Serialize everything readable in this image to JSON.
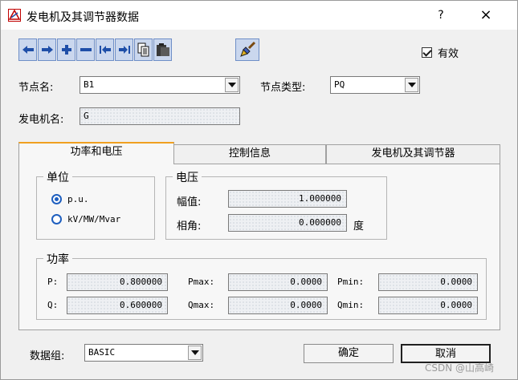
{
  "window": {
    "title": "发电机及其调节器数据",
    "help_label": "?",
    "close_label": "×"
  },
  "toolbar": {
    "buttons": [
      "arrow-left-icon",
      "arrow-right-icon",
      "plus-icon",
      "minus-icon",
      "first-record-icon",
      "last-record-icon",
      "copy-icon",
      "paste-icon"
    ],
    "brush": "brush-icon"
  },
  "valid_checkbox": {
    "label": "有效",
    "checked": true
  },
  "node": {
    "name_label": "节点名:",
    "name_value": "B1",
    "type_label": "节点类型:",
    "type_value": "PQ"
  },
  "generator": {
    "name_label": "发电机名:",
    "name_value": "G"
  },
  "tabs": [
    {
      "label": "功率和电压",
      "active": true
    },
    {
      "label": "控制信息",
      "active": false
    },
    {
      "label": "发电机及其调节器",
      "active": false
    }
  ],
  "unit_group": {
    "title": "单位",
    "options": [
      {
        "label": "p.u.",
        "selected": true
      },
      {
        "label": "kV/MW/Mvar",
        "selected": false
      }
    ]
  },
  "voltage_group": {
    "title": "电压",
    "magnitude_label": "幅值:",
    "magnitude_value": "1.000000",
    "angle_label": "相角:",
    "angle_value": "0.000000",
    "angle_unit": "度"
  },
  "power_group": {
    "title": "功率",
    "p_label": "P:",
    "p_value": "0.800000",
    "q_label": "Q:",
    "q_value": "0.600000",
    "pmax_label": "Pmax:",
    "pmax_value": "0.0000",
    "qmax_label": "Qmax:",
    "qmax_value": "0.0000",
    "pmin_label": "Pmin:",
    "pmin_value": "0.0000",
    "qmin_label": "Qmin:",
    "qmin_value": "0.0000"
  },
  "footer": {
    "group_label": "数据组:",
    "group_value": "BASIC",
    "ok_label": "确定",
    "cancel_label": "取消"
  },
  "watermark": "CSDN @山高崎",
  "colors": {
    "toolbar_bg": "#cad7ee",
    "toolbar_icon": "#1f4fa8",
    "tab_accent": "#f0a020",
    "radio": "#1f5fbf"
  }
}
